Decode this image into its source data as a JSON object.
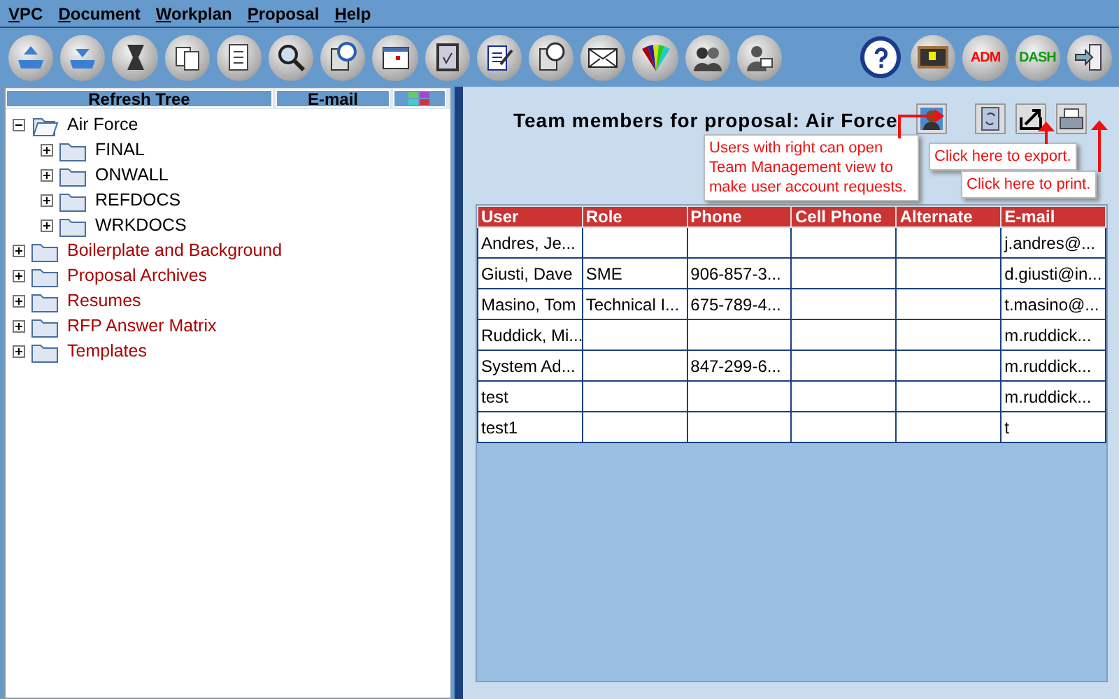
{
  "menu": [
    "VPC",
    "Document",
    "Workplan",
    "Proposal",
    "Help"
  ],
  "toolbar": {
    "badges": [
      {
        "label": "ADM",
        "color": "#ff0000"
      },
      {
        "label": "DASH",
        "color": "#119911"
      }
    ]
  },
  "tree": {
    "header": [
      "Refresh Tree",
      "E-mail"
    ],
    "items": [
      {
        "label": "Air Force",
        "expanded": true,
        "color": "#000000",
        "children": [
          {
            "label": "FINAL",
            "expanded": false,
            "color": "#000000"
          },
          {
            "label": "ONWALL",
            "expanded": false,
            "color": "#000000"
          },
          {
            "label": "REFDOCS",
            "expanded": false,
            "color": "#000000"
          },
          {
            "label": "WRKDOCS",
            "expanded": false,
            "color": "#000000"
          }
        ]
      },
      {
        "label": "Boilerplate and Background",
        "expanded": false,
        "color": "#aa0000"
      },
      {
        "label": "Proposal Archives",
        "expanded": false,
        "color": "#aa0000"
      },
      {
        "label": "Resumes",
        "expanded": false,
        "color": "#aa0000"
      },
      {
        "label": "RFP Answer Matrix",
        "expanded": false,
        "color": "#aa0000"
      },
      {
        "label": "Templates",
        "expanded": false,
        "color": "#aa0000"
      }
    ]
  },
  "team": {
    "title": "Team members for proposal: Air Force",
    "callouts": [
      "Users with right can open Team Management view to make user account requests.",
      "Click here to export.",
      "Click here to print."
    ],
    "table": {
      "columns": [
        "User",
        "Role",
        "Phone",
        "Cell Phone",
        "Alternate",
        "E-mail"
      ],
      "rows": [
        {
          "cells": [
            "Andres, Je...",
            "",
            "",
            "",
            "",
            "j.andres@..."
          ]
        },
        {
          "cells": [
            "Giusti, Dave",
            "SME",
            "906-857-3...",
            "",
            "",
            "d.giusti@in..."
          ]
        },
        {
          "cells": [
            "Masino, Tom",
            "Technical I...",
            "675-789-4...",
            "",
            "",
            "t.masino@..."
          ]
        },
        {
          "cells": [
            "Ruddick, Mi...",
            "",
            "",
            "",
            "",
            "m.ruddick..."
          ]
        },
        {
          "cells": [
            "System Ad...",
            "",
            "847-299-6...",
            "",
            "",
            "m.ruddick..."
          ]
        },
        {
          "cells": [
            "test",
            "",
            "",
            "",
            "",
            "m.ruddick..."
          ]
        },
        {
          "cells": [
            "test1",
            "",
            "",
            "",
            "",
            "t"
          ]
        }
      ]
    }
  }
}
